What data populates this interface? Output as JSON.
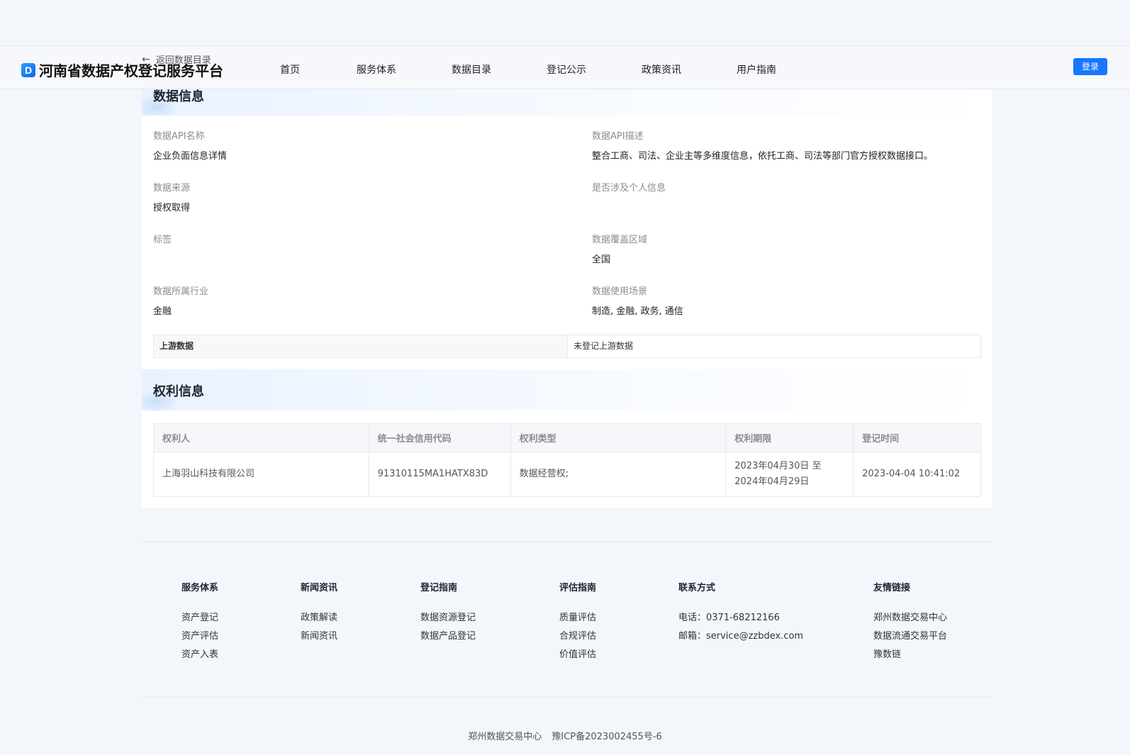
{
  "header": {
    "logo_mark": "D",
    "site_title": "河南省数据产权登记服务平台",
    "nav": [
      "首页",
      "服务体系",
      "数据目录",
      "登记公示",
      "政策资讯",
      "用户指南"
    ],
    "login_label": "登录"
  },
  "back_link": {
    "arrow": "←",
    "label": "返回数据目录"
  },
  "data_info": {
    "title": "数据信息",
    "fields": {
      "api_name": {
        "label": "数据API名称",
        "value": "企业负面信息详情"
      },
      "api_desc": {
        "label": "数据API描述",
        "value": "整合工商、司法、企业主等多维度信息，依托工商、司法等部门官方授权数据接口。"
      },
      "source": {
        "label": "数据来源",
        "value": "授权取得"
      },
      "personal_info": {
        "label": "是否涉及个人信息",
        "value": ""
      },
      "tags": {
        "label": "标签",
        "value": ""
      },
      "coverage": {
        "label": "数据覆盖区域",
        "value": "全国"
      },
      "industry": {
        "label": "数据所属行业",
        "value": "金融"
      },
      "scenario": {
        "label": "数据使用场景",
        "value": "制造, 金融, 政务, 通信"
      }
    },
    "upstream": {
      "label": "上游数据",
      "value": "未登记上游数据"
    }
  },
  "rights_info": {
    "title": "权利信息",
    "columns": [
      "权利人",
      "统一社会信用代码",
      "权利类型",
      "权利期限",
      "登记时间"
    ],
    "row": {
      "holder": "上海羽山科技有限公司",
      "credit_code": "91310115MA1HATX83D",
      "right_type": "数据经营权;",
      "term_line1": "2023年04月30日 至",
      "term_line2": "2024年04月29日",
      "registered_at": "2023-04-04 10:41:02"
    }
  },
  "footer": {
    "columns": [
      {
        "heading": "服务体系",
        "items": [
          "资产登记",
          "资产评估",
          "资产入表"
        ]
      },
      {
        "heading": "新闻资讯",
        "items": [
          "政策解读",
          "新闻资讯"
        ]
      },
      {
        "heading": "登记指南",
        "items": [
          "数据资源登记",
          "数据产品登记"
        ]
      },
      {
        "heading": "评估指南",
        "items": [
          "质量评估",
          "合规评估",
          "价值评估"
        ]
      },
      {
        "heading": "联系方式",
        "items": [
          "电话：0371-68212166",
          "邮箱：service@zzbdex.com"
        ]
      },
      {
        "heading": "友情链接",
        "items": [
          "郑州数据交易中心",
          "数据流通交易平台",
          "豫数链"
        ]
      }
    ],
    "org": "郑州数据交易中心",
    "icp": "豫ICP备2023002455号-6"
  }
}
